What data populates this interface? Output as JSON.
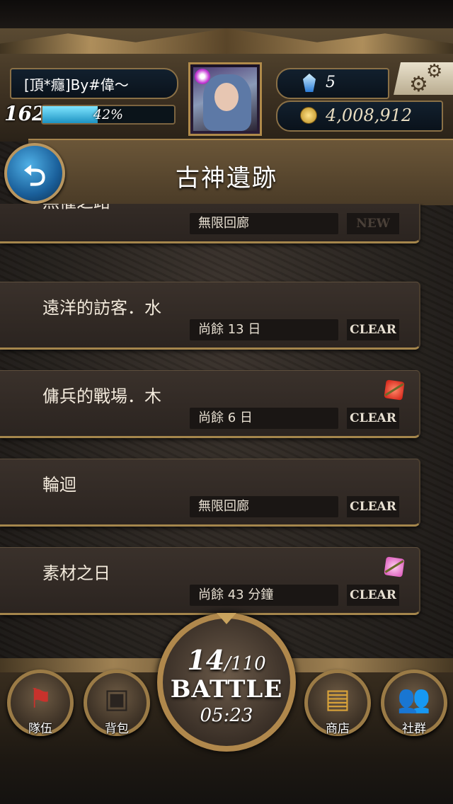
{
  "player": {
    "name": "[頂*癮]By#偉～",
    "level": "162",
    "exp_percent_text": "42%",
    "exp_fraction": 0.42,
    "gems": "5",
    "coins": "4,008,912"
  },
  "page": {
    "title": "古神遺跡"
  },
  "dungeons": [
    {
      "name": "無懼之路",
      "period": "無限回廊",
      "status": "NEW",
      "stamp": null
    },
    {
      "name": "遠洋的訪客．水",
      "period": "尚餘 13 日",
      "status": "CLEAR",
      "stamp": null
    },
    {
      "name": "傭兵的戰場．木",
      "period": "尚餘 6 日",
      "status": "CLEAR",
      "stamp": "red"
    },
    {
      "name": "輪迴",
      "period": "無限回廊",
      "status": "CLEAR",
      "stamp": null
    },
    {
      "name": "素材之日",
      "period": "尚餘 43 分鐘",
      "status": "CLEAR",
      "stamp": "pink"
    }
  ],
  "battle": {
    "stamina_current": "14",
    "stamina_max": "/110",
    "label": "BATTLE",
    "timer": "05:23"
  },
  "nav": {
    "team": "隊伍",
    "bag": "背包",
    "shop": "商店",
    "social": "社群"
  },
  "colors": {
    "accent_gold": "#b89660",
    "exp_blue": "#1d93c2",
    "back_button": "#1a5f9a"
  }
}
